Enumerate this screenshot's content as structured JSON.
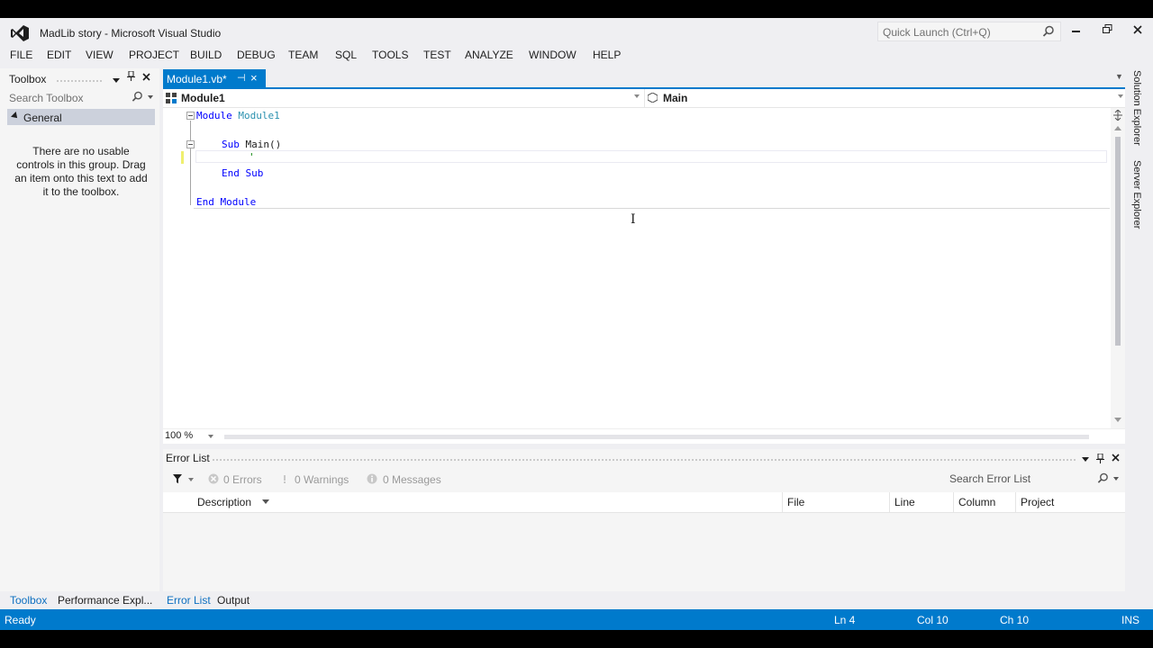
{
  "window": {
    "title": "MadLib story - Microsoft Visual Studio",
    "quick_launch_placeholder": "Quick Launch (Ctrl+Q)"
  },
  "menu": [
    "FILE",
    "EDIT",
    "VIEW",
    "PROJECT",
    "BUILD",
    "DEBUG",
    "TEAM",
    "SQL",
    "TOOLS",
    "TEST",
    "ANALYZE",
    "WINDOW",
    "HELP"
  ],
  "toolbox": {
    "title": "Toolbox",
    "search_placeholder": "Search Toolbox",
    "group": "General",
    "empty_message": "There are no usable controls in this group. Drag an item onto this text to add it to the toolbox."
  },
  "editor": {
    "tab_label": "Module1.vb*",
    "nav_left": "Module1",
    "nav_right": "Main",
    "code": {
      "line1_kw": "Module",
      "line1_name": "Module1",
      "line2_kw": "Sub",
      "line2_rest": "Main()",
      "line3": "'",
      "line4": "End Sub",
      "line5": "End Module"
    },
    "zoom": "100 %"
  },
  "error_list": {
    "title": "Error List",
    "errors": "0 Errors",
    "warnings": "0 Warnings",
    "messages": "0 Messages",
    "search_placeholder": "Search Error List",
    "columns": [
      "Description",
      "File",
      "Line",
      "Column",
      "Project"
    ]
  },
  "bottom_tabs_left": [
    "Toolbox",
    "Performance Expl..."
  ],
  "bottom_tabs_right": [
    "Error List",
    "Output"
  ],
  "side_tabs": [
    "Solution Explorer",
    "Server Explorer"
  ],
  "status": {
    "state": "Ready",
    "line": "Ln 4",
    "col": "Col 10",
    "ch": "Ch 10",
    "mode": "INS"
  },
  "colors": {
    "accent": "#007acc",
    "keyword": "#0000ff",
    "type": "#2b91af"
  }
}
